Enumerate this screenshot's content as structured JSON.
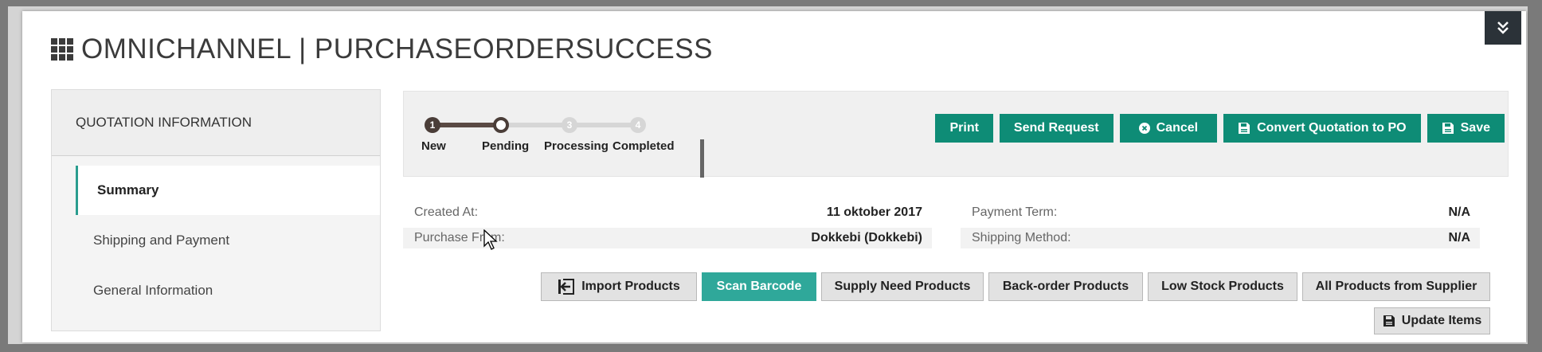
{
  "page": {
    "title": "OMNICHANNEL | PURCHASEORDERSUCCESS"
  },
  "sidebar": {
    "heading": "QUOTATION INFORMATION",
    "items": [
      {
        "label": "Summary",
        "active": true
      },
      {
        "label": "Shipping and Payment",
        "active": false
      },
      {
        "label": "General Information",
        "active": false
      }
    ]
  },
  "progress": {
    "steps": [
      {
        "number": "1",
        "label": "New",
        "state": "done"
      },
      {
        "number": "",
        "label": "Pending",
        "state": "current"
      },
      {
        "number": "3",
        "label": "Processing",
        "state": "todo"
      },
      {
        "number": "4",
        "label": "Completed",
        "state": "todo"
      }
    ]
  },
  "toolbar": {
    "print": "Print",
    "send_request": "Send Request",
    "cancel": "Cancel",
    "convert": "Convert Quotation to PO",
    "save": "Save"
  },
  "info": {
    "created_at_label": "Created At:",
    "created_at_value": "11 oktober 2017",
    "purchase_from_label": "Purchase From:",
    "purchase_from_value": "Dokkebi (Dokkebi)",
    "payment_term_label": "Payment Term:",
    "payment_term_value": "N/A",
    "shipping_method_label": "Shipping Method:",
    "shipping_method_value": "N/A"
  },
  "items_toolbar": {
    "import_products": "Import Products",
    "scan_barcode": "Scan Barcode",
    "supply_need": "Supply Need Products",
    "back_order": "Back-order Products",
    "low_stock": "Low Stock Products",
    "all_from_supplier": "All Products from Supplier",
    "update_items": "Update Items"
  },
  "colors": {
    "primary_button": "#0e8c76",
    "scan_button": "#2fa89a",
    "active_accent": "#2a9d8f",
    "collapse_button": "#2b3238"
  },
  "icons": {
    "title": "grid-icon",
    "collapse": "double-chevron-down-icon",
    "cancel": "close-circle-icon",
    "convert": "floppy-icon",
    "save": "floppy-icon",
    "import": "import-icon",
    "update": "floppy-icon"
  }
}
